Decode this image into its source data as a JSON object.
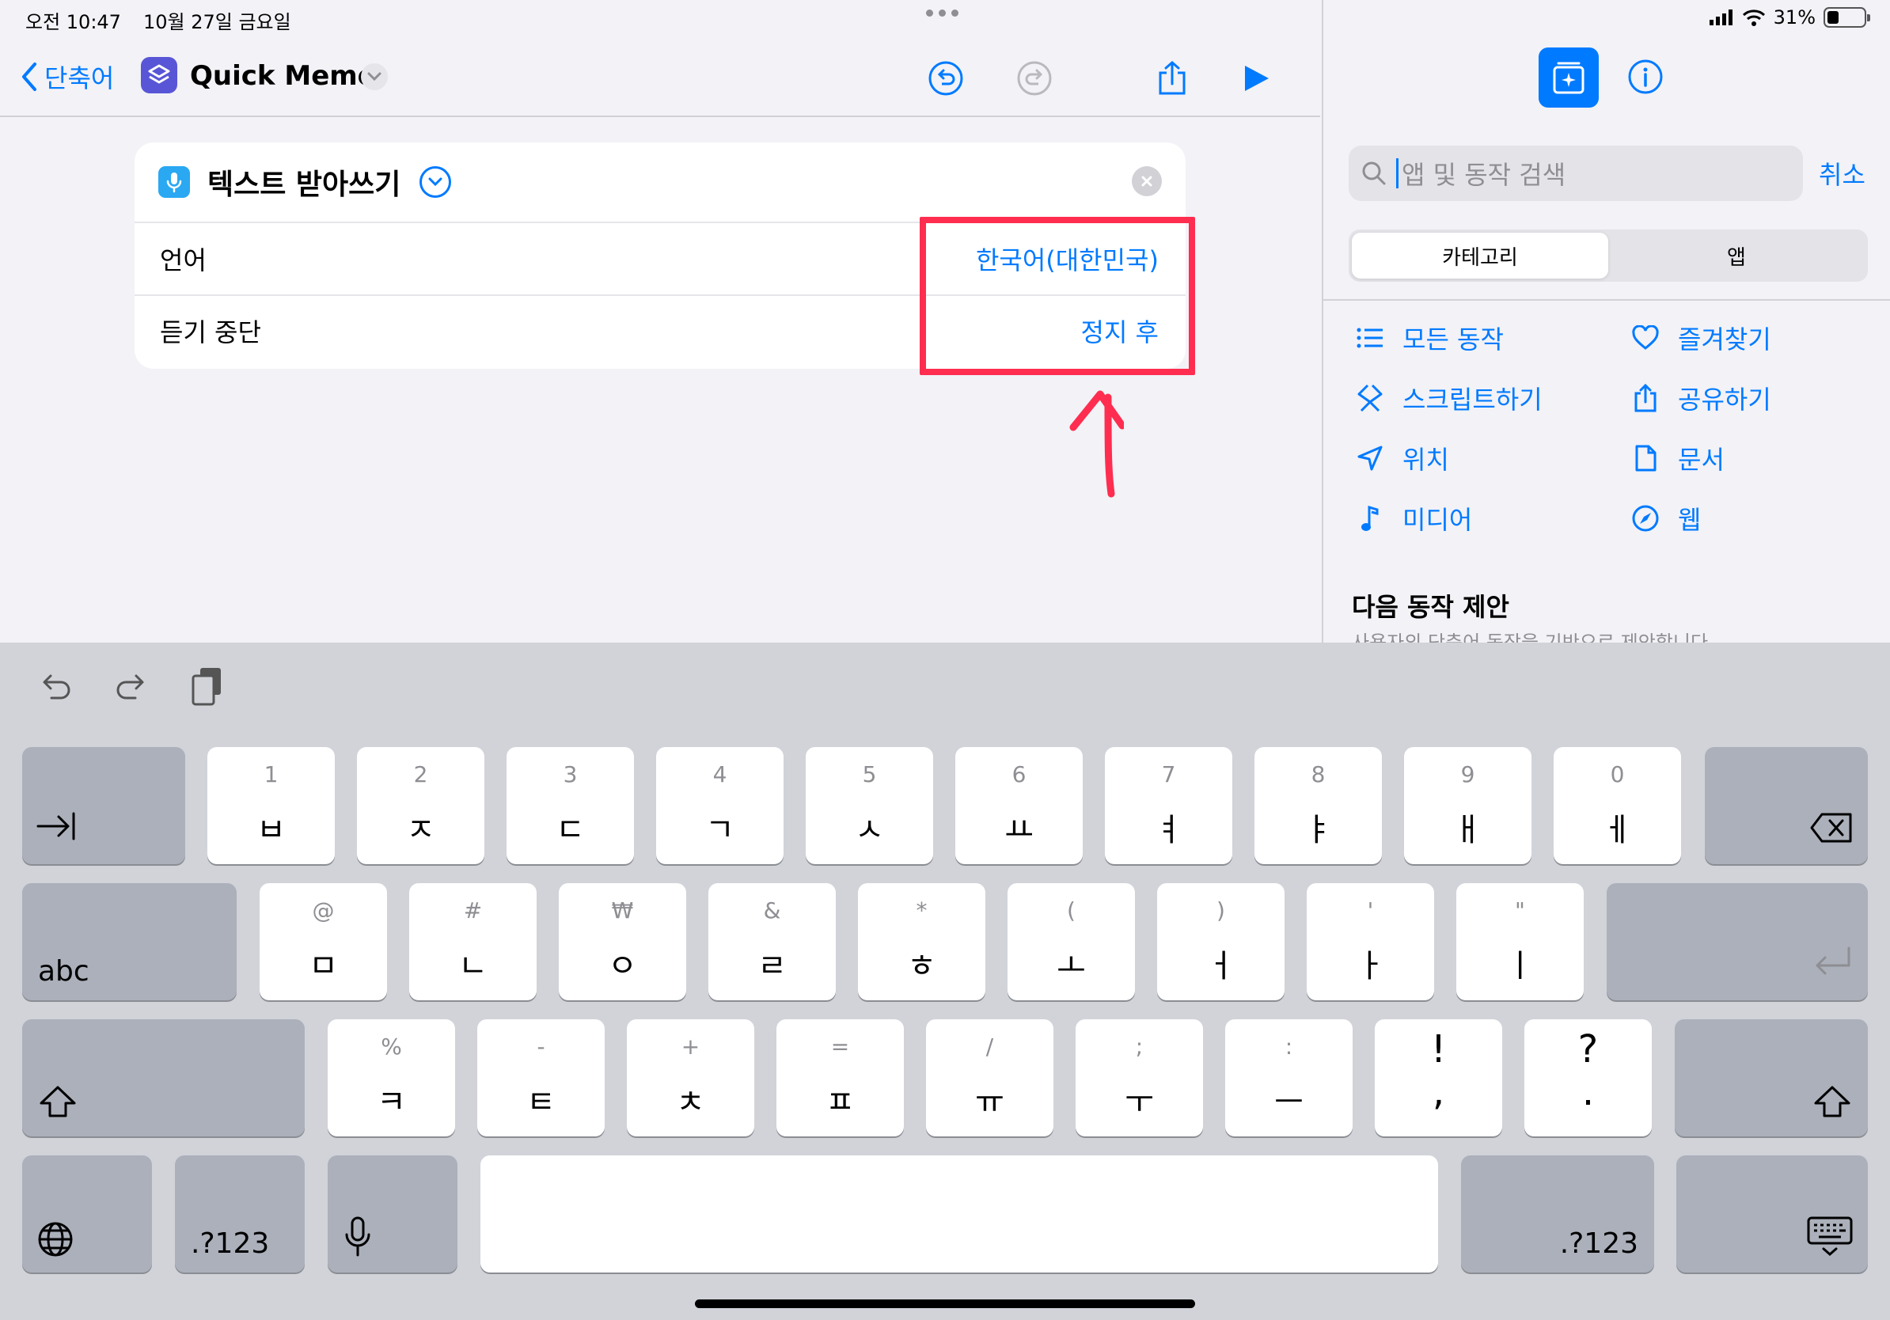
{
  "status": {
    "time": "오전 10:47",
    "date": "10월 27일 금요일",
    "battery": "31%"
  },
  "toolbar": {
    "back_label": "단축어",
    "title": "Quick Memo"
  },
  "action_card": {
    "title": "텍스트 받아쓰기",
    "rows": [
      {
        "label": "언어",
        "value": "한국어(대한민국)"
      },
      {
        "label": "듣기 중단",
        "value": "정지 후"
      }
    ]
  },
  "sidebar": {
    "search_placeholder": "앱 및 동작 검색",
    "cancel": "취소",
    "segments": [
      "카테고리",
      "앱"
    ],
    "categories": [
      {
        "label": "모든 동작",
        "icon": "list-icon"
      },
      {
        "label": "즐겨찾기",
        "icon": "heart-icon"
      },
      {
        "label": "스크립트하기",
        "icon": "script-icon"
      },
      {
        "label": "공유하기",
        "icon": "share-icon"
      },
      {
        "label": "위치",
        "icon": "location-icon"
      },
      {
        "label": "문서",
        "icon": "document-icon"
      },
      {
        "label": "미디어",
        "icon": "music-note-icon"
      },
      {
        "label": "웹",
        "icon": "compass-icon"
      }
    ],
    "suggestions_title": "다음 동작 제안",
    "suggestions_subtitle": "사용자의 단축어 동작을 기반으로 제안합니다"
  },
  "keyboard": {
    "row1": [
      {
        "sub": "1",
        "main": "ㅂ"
      },
      {
        "sub": "2",
        "main": "ㅈ"
      },
      {
        "sub": "3",
        "main": "ㄷ"
      },
      {
        "sub": "4",
        "main": "ㄱ"
      },
      {
        "sub": "5",
        "main": "ㅅ"
      },
      {
        "sub": "6",
        "main": "ㅛ"
      },
      {
        "sub": "7",
        "main": "ㅕ"
      },
      {
        "sub": "8",
        "main": "ㅑ"
      },
      {
        "sub": "9",
        "main": "ㅐ"
      },
      {
        "sub": "0",
        "main": "ㅔ"
      }
    ],
    "row2": [
      {
        "sub": "@",
        "main": "ㅁ"
      },
      {
        "sub": "#",
        "main": "ㄴ"
      },
      {
        "sub": "₩",
        "main": "ㅇ"
      },
      {
        "sub": "&",
        "main": "ㄹ"
      },
      {
        "sub": "*",
        "main": "ㅎ"
      },
      {
        "sub": "(",
        "main": "ㅗ"
      },
      {
        "sub": ")",
        "main": "ㅓ"
      },
      {
        "sub": "'",
        "main": "ㅏ"
      },
      {
        "sub": "\"",
        "main": "ㅣ"
      }
    ],
    "row3": [
      {
        "sub": "%",
        "main": "ㅋ"
      },
      {
        "sub": "-",
        "main": "ㅌ"
      },
      {
        "sub": "+",
        "main": "ㅊ"
      },
      {
        "sub": "=",
        "main": "ㅍ"
      },
      {
        "sub": "/",
        "main": "ㅠ"
      },
      {
        "sub": ";",
        "main": "ㅜ"
      },
      {
        "sub": ":",
        "main": "ㅡ"
      },
      {
        "sub": "!",
        "main": ","
      },
      {
        "sub": "?",
        "main": "."
      }
    ],
    "abc": "abc",
    "num_left": ".?123",
    "num_right": ".?123"
  }
}
